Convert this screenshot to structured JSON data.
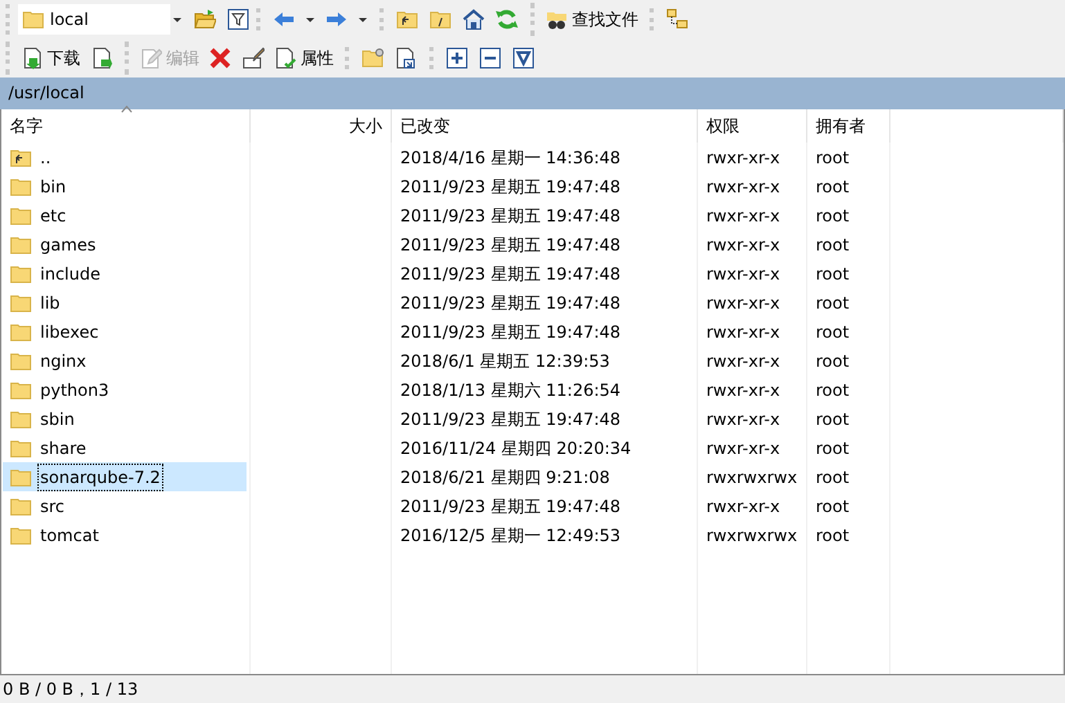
{
  "toolbar_1": {
    "path_combo": {
      "value": "local"
    },
    "groups": [
      [
        {
          "kind": "open-folder"
        },
        {
          "kind": "filter"
        }
      ],
      [
        {
          "kind": "back"
        },
        {
          "kind": "caret"
        },
        {
          "kind": "forward"
        },
        {
          "kind": "caret"
        }
      ],
      [
        {
          "kind": "parent"
        },
        {
          "kind": "root"
        },
        {
          "kind": "home"
        },
        {
          "kind": "refresh"
        }
      ],
      [
        {
          "kind": "find",
          "label": "查找文件"
        }
      ],
      [
        {
          "kind": "tree"
        }
      ]
    ]
  },
  "toolbar_2": {
    "groups": [
      [
        {
          "kind": "download",
          "label": "下载",
          "disabled": false
        },
        {
          "kind": "download-alt",
          "disabled": false
        }
      ],
      [
        {
          "kind": "edit",
          "label": "编辑",
          "disabled": true
        },
        {
          "kind": "delete",
          "disabled": false
        },
        {
          "kind": "rename",
          "disabled": false
        },
        {
          "kind": "properties",
          "label": "属性",
          "disabled": false
        }
      ],
      [
        {
          "kind": "new-folder",
          "disabled": false
        },
        {
          "kind": "shortcut",
          "disabled": false
        }
      ],
      [
        {
          "kind": "plus",
          "disabled": false
        },
        {
          "kind": "minus",
          "disabled": false
        },
        {
          "kind": "select-filter",
          "disabled": false
        }
      ]
    ]
  },
  "path_bar": "/usr/local",
  "table": {
    "columns": [
      {
        "label": "名字",
        "sorted": true
      },
      {
        "label": "大小",
        "sorted": false
      },
      {
        "label": "已改变",
        "sorted": false
      },
      {
        "label": "权限",
        "sorted": false
      },
      {
        "label": "拥有者",
        "sorted": false
      }
    ],
    "rows": [
      {
        "kind": "parent",
        "name": "..",
        "modified": "2018/4/16 星期一 14:36:48",
        "rights": "rwxr-xr-x",
        "owner": "root",
        "selected": false
      },
      {
        "kind": "folder",
        "name": "bin",
        "modified": "2011/9/23 星期五 19:47:48",
        "rights": "rwxr-xr-x",
        "owner": "root",
        "selected": false
      },
      {
        "kind": "folder",
        "name": "etc",
        "modified": "2011/9/23 星期五 19:47:48",
        "rights": "rwxr-xr-x",
        "owner": "root",
        "selected": false
      },
      {
        "kind": "folder",
        "name": "games",
        "modified": "2011/9/23 星期五 19:47:48",
        "rights": "rwxr-xr-x",
        "owner": "root",
        "selected": false
      },
      {
        "kind": "folder",
        "name": "include",
        "modified": "2011/9/23 星期五 19:47:48",
        "rights": "rwxr-xr-x",
        "owner": "root",
        "selected": false
      },
      {
        "kind": "folder",
        "name": "lib",
        "modified": "2011/9/23 星期五 19:47:48",
        "rights": "rwxr-xr-x",
        "owner": "root",
        "selected": false
      },
      {
        "kind": "folder",
        "name": "libexec",
        "modified": "2011/9/23 星期五 19:47:48",
        "rights": "rwxr-xr-x",
        "owner": "root",
        "selected": false
      },
      {
        "kind": "folder",
        "name": "nginx",
        "modified": "2018/6/1 星期五 12:39:53",
        "rights": "rwxr-xr-x",
        "owner": "root",
        "selected": false
      },
      {
        "kind": "folder",
        "name": "python3",
        "modified": "2018/1/13 星期六 11:26:54",
        "rights": "rwxr-xr-x",
        "owner": "root",
        "selected": false
      },
      {
        "kind": "folder",
        "name": "sbin",
        "modified": "2011/9/23 星期五 19:47:48",
        "rights": "rwxr-xr-x",
        "owner": "root",
        "selected": false
      },
      {
        "kind": "folder",
        "name": "share",
        "modified": "2016/11/24 星期四 20:20:34",
        "rights": "rwxr-xr-x",
        "owner": "root",
        "selected": false
      },
      {
        "kind": "folder",
        "name": "sonarqube-7.2",
        "modified": "2018/6/21 星期四 9:21:08",
        "rights": "rwxrwxrwx",
        "owner": "root",
        "selected": true
      },
      {
        "kind": "folder",
        "name": "src",
        "modified": "2011/9/23 星期五 19:47:48",
        "rights": "rwxr-xr-x",
        "owner": "root",
        "selected": false
      },
      {
        "kind": "folder",
        "name": "tomcat",
        "modified": "2016/12/5 星期一 12:49:53",
        "rights": "rwxrwxrwx",
        "owner": "root",
        "selected": false
      }
    ]
  },
  "status_bar": "0 B / 0 B，1 / 13"
}
